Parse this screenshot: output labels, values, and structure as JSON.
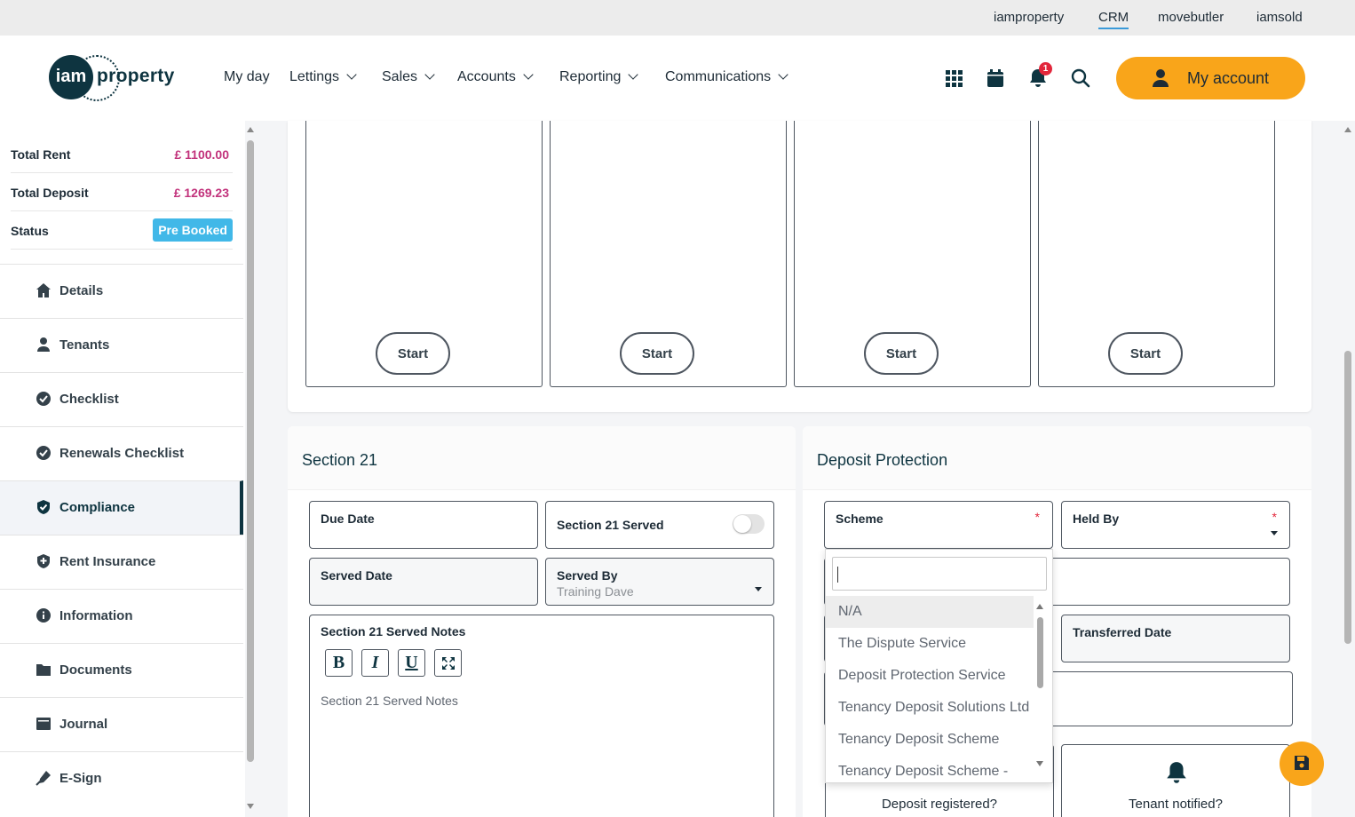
{
  "top_links": [
    "iamproperty",
    "CRM",
    "movebutler",
    "iamsold"
  ],
  "brand": {
    "mark": "iam",
    "word": "property"
  },
  "nav": [
    "My day",
    "Lettings",
    "Sales",
    "Accounts",
    "Reporting",
    "Communications"
  ],
  "header": {
    "notification_count": "1",
    "account_label": "My account"
  },
  "summary": {
    "total_rent_label": "Total Rent",
    "total_rent_value": "£ 1100.00",
    "total_deposit_label": "Total Deposit",
    "total_deposit_value": "£ 1269.23",
    "status_label": "Status",
    "status_value": "Pre Booked"
  },
  "sidebar": [
    "Details",
    "Tenants",
    "Checklist",
    "Renewals Checklist",
    "Compliance",
    "Rent Insurance",
    "Information",
    "Documents",
    "Journal",
    "E-Sign"
  ],
  "start_label": "Start",
  "section21": {
    "title": "Section 21",
    "due_date_label": "Due Date",
    "served_label": "Section 21 Served",
    "served_date_label": "Served Date",
    "served_by_label": "Served By",
    "served_by_value": "Training Dave",
    "notes_label": "Section 21 Served Notes",
    "notes_placeholder": "Section 21 Served Notes",
    "fmt": [
      "B",
      "I",
      "U"
    ]
  },
  "deposit": {
    "title": "Deposit Protection",
    "scheme_label": "Scheme",
    "held_by_label": "Held By",
    "required_mark": "*",
    "transferred_label": "Transferred Date",
    "registered_label": "Deposit registered?",
    "notified_label": "Tenant notified?"
  },
  "scheme_options": [
    "N/A",
    "The Dispute Service",
    "Deposit Protection Service",
    "Tenancy Deposit Solutions Ltd",
    "Tenancy Deposit Scheme",
    "Tenancy Deposit Scheme -"
  ],
  "colors": {
    "accent": "#f9a51a",
    "brand": "#0e3440",
    "money": "#c2337c",
    "status": "#41b8e8"
  }
}
